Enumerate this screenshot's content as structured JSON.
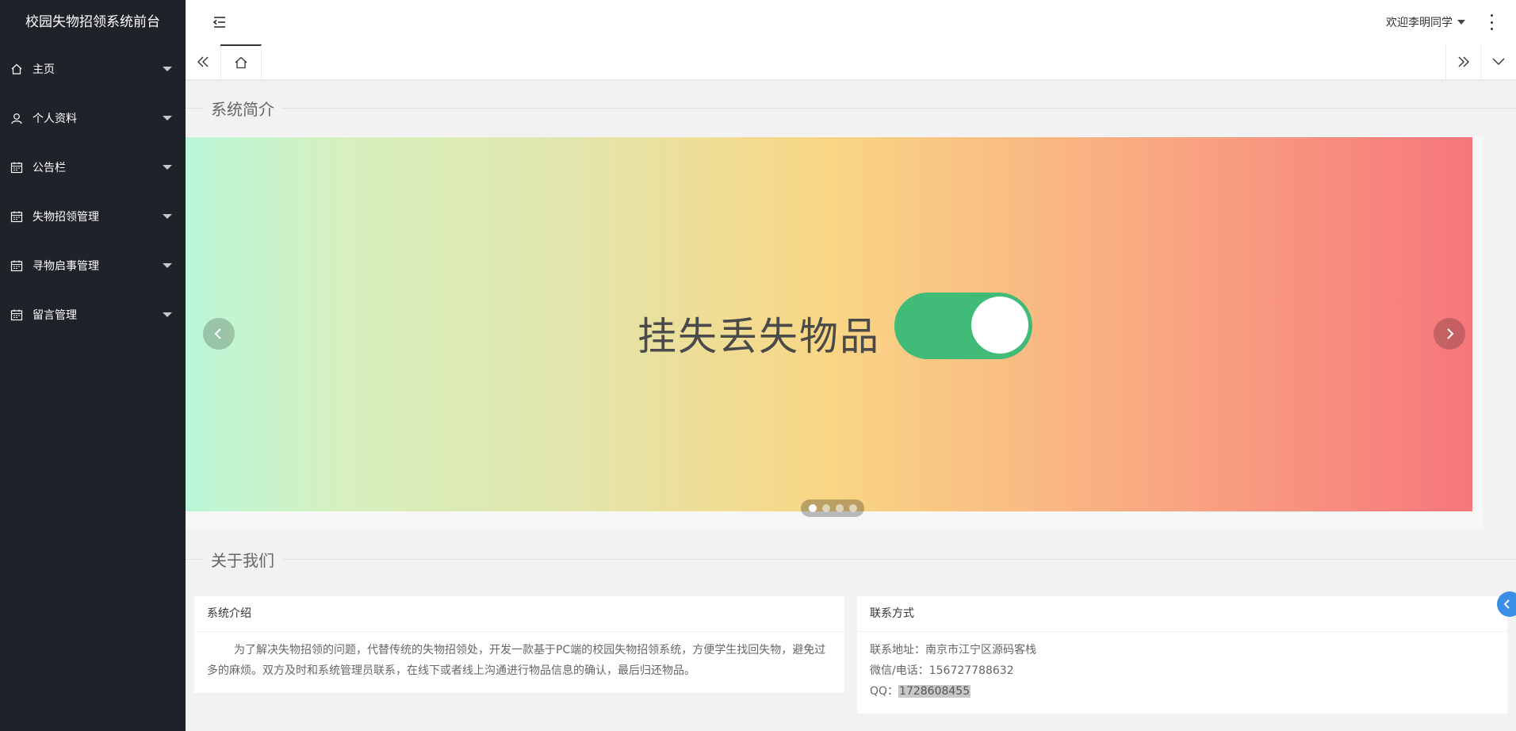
{
  "sidebar": {
    "title": "校园失物招领系统前台",
    "items": [
      {
        "label": "主页",
        "icon": "home-icon"
      },
      {
        "label": "个人资料",
        "icon": "user-icon"
      },
      {
        "label": "公告栏",
        "icon": "calendar-icon"
      },
      {
        "label": "失物招领管理",
        "icon": "calendar-icon"
      },
      {
        "label": "寻物启事管理",
        "icon": "calendar-icon"
      },
      {
        "label": "留言管理",
        "icon": "calendar-icon"
      }
    ]
  },
  "header": {
    "welcome": "欢迎李明同学"
  },
  "sections": {
    "intro_title": "系统简介",
    "about_title": "关于我们"
  },
  "carousel": {
    "slide_text": "挂失丢失物品",
    "dot_count": 4,
    "active_dot": 1
  },
  "intro_card": {
    "title": "系统介绍",
    "body": "为了解决失物招领的问题，代替传统的失物招领处，开发一款基于PC端的校园失物招领系统，方便学生找回失物，避免过多的麻烦。双方及时和系统管理员联系，在线下或者线上沟通进行物品信息的确认，最后归还物品。"
  },
  "contact_card": {
    "title": "联系方式",
    "address_label": "联系地址：",
    "address": "南京市江宁区源码客栈",
    "phone_label": "微信/电话：",
    "phone": "156727788632",
    "qq_label": "QQ：",
    "qq": "1728608455"
  },
  "colors": {
    "sidebar_bg": "#20222a",
    "toggle_green": "#40bb78",
    "float_button": "#3a8ee6"
  }
}
